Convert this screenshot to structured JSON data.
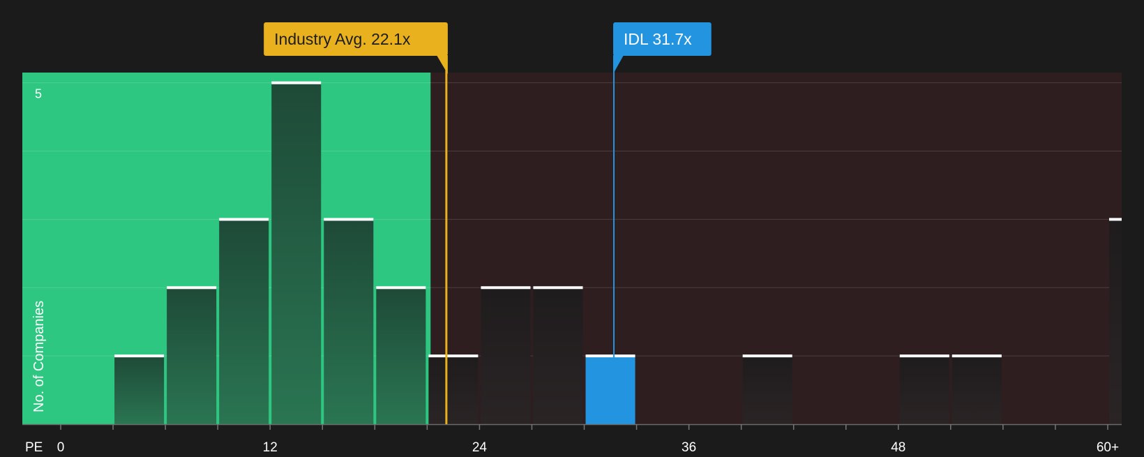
{
  "chart_data": {
    "type": "bar",
    "metric_label": "PE",
    "ylabel": "No. of Companies",
    "x_ticks": [
      "0",
      "12",
      "24",
      "36",
      "48",
      "60+"
    ],
    "x_tick_values": [
      0,
      12,
      24,
      36,
      48,
      60
    ],
    "y_tick_labels": [
      "5"
    ],
    "y_tick_values": [
      5
    ],
    "xlim": [
      -2.2,
      60.8
    ],
    "ylim": [
      0,
      5.15
    ],
    "grid": true,
    "bins": [
      {
        "x0": 3,
        "x1": 6,
        "value": 1
      },
      {
        "x0": 6,
        "x1": 9,
        "value": 2
      },
      {
        "x0": 9,
        "x1": 12,
        "value": 3
      },
      {
        "x0": 12,
        "x1": 15,
        "value": 5
      },
      {
        "x0": 15,
        "x1": 18,
        "value": 3
      },
      {
        "x0": 18,
        "x1": 21,
        "value": 2
      },
      {
        "x0": 21,
        "x1": 24,
        "value": 1
      },
      {
        "x0": 24,
        "x1": 27,
        "value": 2
      },
      {
        "x0": 27,
        "x1": 30,
        "value": 2
      },
      {
        "x0": 30,
        "x1": 33,
        "value": 1,
        "highlight": true
      },
      {
        "x0": 39,
        "x1": 42,
        "value": 1
      },
      {
        "x0": 48,
        "x1": 51,
        "value": 1
      },
      {
        "x0": 51,
        "x1": 54,
        "value": 1
      },
      {
        "x0": 60,
        "x1": 61.5,
        "value": 3
      }
    ],
    "fair_region_end": 21.2,
    "markers": [
      {
        "label": "Industry Avg. 22.1x",
        "value": 22.1,
        "color": "#e9b11e",
        "text_color": "#1d1d1d"
      },
      {
        "label": "IDL 31.7x",
        "value": 31.7,
        "color": "#2394e0",
        "text_color": "#ffffff"
      }
    ],
    "colors": {
      "background": "#1b1b1c",
      "fair_region": "#2ec781",
      "expensive_region": "#2f1e20",
      "bar_in_fair": "#24503e",
      "bar_dark": "#231f20",
      "highlight_bar": "#2394e0",
      "bar_cap": "#ffffff",
      "axis_text": "#ffffff"
    }
  }
}
